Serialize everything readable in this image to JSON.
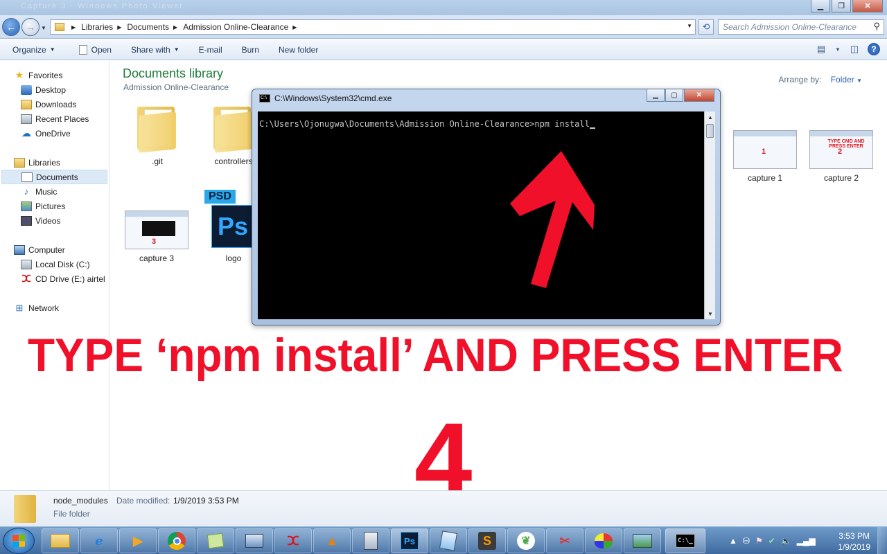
{
  "window": {
    "title": "Capture 3 - Windows Photo Viewer"
  },
  "address": {
    "crumbs": [
      "Libraries",
      "Documents",
      "Admission Online-Clearance"
    ],
    "search_placeholder": "Search Admission Online-Clearance"
  },
  "toolbar": {
    "organize": "Organize",
    "open": "Open",
    "share_with": "Share with",
    "email": "E-mail",
    "burn": "Burn",
    "new_folder": "New folder"
  },
  "nav": {
    "favorites": "Favorites",
    "desktop": "Desktop",
    "downloads": "Downloads",
    "recent_places": "Recent Places",
    "onedrive": "OneDrive",
    "libraries": "Libraries",
    "documents": "Documents",
    "music": "Music",
    "pictures": "Pictures",
    "videos": "Videos",
    "computer": "Computer",
    "local_disk": "Local Disk (C:)",
    "cd_drive": "CD Drive (E:) airtel",
    "network": "Network"
  },
  "content": {
    "library_title": "Documents library",
    "library_sub": "Admission Online-Clearance",
    "arrange_label": "Arrange by:",
    "arrange_value": "Folder",
    "files": {
      "git": ".git",
      "controllers": "controllers",
      "capture1": "capture 1",
      "capture2": "capture 2",
      "capture3": "capture 3",
      "logo": "logo"
    },
    "thumb_labels": {
      "c1": "1",
      "c2": "2",
      "c3": "3",
      "c2_text": "TYPE CMD AND PRESS ENTER",
      "psd_tag": "PSD",
      "psd_body": "Ps"
    }
  },
  "cmd": {
    "title": "C:\\Windows\\System32\\cmd.exe",
    "line": "C:\\Users\\Ojonugwa\\Documents\\Admission Online-Clearance>npm install"
  },
  "overlay": {
    "instruction": "TYPE ‘npm install’ AND PRESS ENTER",
    "step_number": "4",
    "color": "#f0102a"
  },
  "details": {
    "name": "node_modules",
    "modified_label": "Date modified:",
    "modified_value": "1/9/2019 3:53 PM",
    "type": "File folder"
  },
  "taskbar": {
    "apps": [
      "windows-explorer",
      "internet-explorer",
      "media-player",
      "chrome",
      "sticky-notes",
      "control-panel",
      "airtel",
      "vlc",
      "calculator",
      "photoshop",
      "notepad",
      "sublime-text",
      "mongodb",
      "snipping-tool",
      "paint",
      "photo-viewer",
      "cmd"
    ],
    "time": "3:53 PM",
    "date": "1/9/2019"
  }
}
